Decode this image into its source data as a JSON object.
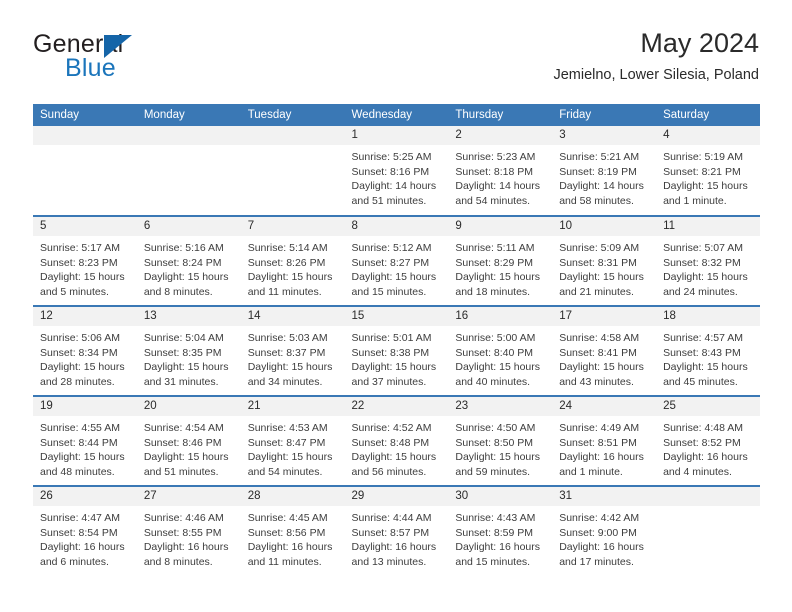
{
  "brand": {
    "name_part1": "General",
    "name_part2": "Blue",
    "triangle_color": "#1565a8",
    "blue_color": "#1b75bb"
  },
  "header": {
    "title": "May 2024",
    "subtitle": "Jemielno, Lower Silesia, Poland"
  },
  "theme": {
    "header_blue": "#3a78b5",
    "daynum_band": "#f2f2f2",
    "text": "#3d3d3d"
  },
  "labels": {
    "sunrise_prefix": "Sunrise:",
    "sunset_prefix": "Sunset:",
    "daylight_prefix": "Daylight:"
  },
  "weekdays": [
    "Sunday",
    "Monday",
    "Tuesday",
    "Wednesday",
    "Thursday",
    "Friday",
    "Saturday"
  ],
  "weeks": [
    [
      {
        "day": "",
        "sunrise": "",
        "sunset": "",
        "daylight": ""
      },
      {
        "day": "",
        "sunrise": "",
        "sunset": "",
        "daylight": ""
      },
      {
        "day": "",
        "sunrise": "",
        "sunset": "",
        "daylight": ""
      },
      {
        "day": "1",
        "sunrise": "Sunrise: 5:25 AM",
        "sunset": "Sunset: 8:16 PM",
        "daylight": "Daylight: 14 hours and 51 minutes."
      },
      {
        "day": "2",
        "sunrise": "Sunrise: 5:23 AM",
        "sunset": "Sunset: 8:18 PM",
        "daylight": "Daylight: 14 hours and 54 minutes."
      },
      {
        "day": "3",
        "sunrise": "Sunrise: 5:21 AM",
        "sunset": "Sunset: 8:19 PM",
        "daylight": "Daylight: 14 hours and 58 minutes."
      },
      {
        "day": "4",
        "sunrise": "Sunrise: 5:19 AM",
        "sunset": "Sunset: 8:21 PM",
        "daylight": "Daylight: 15 hours and 1 minute."
      }
    ],
    [
      {
        "day": "5",
        "sunrise": "Sunrise: 5:17 AM",
        "sunset": "Sunset: 8:23 PM",
        "daylight": "Daylight: 15 hours and 5 minutes."
      },
      {
        "day": "6",
        "sunrise": "Sunrise: 5:16 AM",
        "sunset": "Sunset: 8:24 PM",
        "daylight": "Daylight: 15 hours and 8 minutes."
      },
      {
        "day": "7",
        "sunrise": "Sunrise: 5:14 AM",
        "sunset": "Sunset: 8:26 PM",
        "daylight": "Daylight: 15 hours and 11 minutes."
      },
      {
        "day": "8",
        "sunrise": "Sunrise: 5:12 AM",
        "sunset": "Sunset: 8:27 PM",
        "daylight": "Daylight: 15 hours and 15 minutes."
      },
      {
        "day": "9",
        "sunrise": "Sunrise: 5:11 AM",
        "sunset": "Sunset: 8:29 PM",
        "daylight": "Daylight: 15 hours and 18 minutes."
      },
      {
        "day": "10",
        "sunrise": "Sunrise: 5:09 AM",
        "sunset": "Sunset: 8:31 PM",
        "daylight": "Daylight: 15 hours and 21 minutes."
      },
      {
        "day": "11",
        "sunrise": "Sunrise: 5:07 AM",
        "sunset": "Sunset: 8:32 PM",
        "daylight": "Daylight: 15 hours and 24 minutes."
      }
    ],
    [
      {
        "day": "12",
        "sunrise": "Sunrise: 5:06 AM",
        "sunset": "Sunset: 8:34 PM",
        "daylight": "Daylight: 15 hours and 28 minutes."
      },
      {
        "day": "13",
        "sunrise": "Sunrise: 5:04 AM",
        "sunset": "Sunset: 8:35 PM",
        "daylight": "Daylight: 15 hours and 31 minutes."
      },
      {
        "day": "14",
        "sunrise": "Sunrise: 5:03 AM",
        "sunset": "Sunset: 8:37 PM",
        "daylight": "Daylight: 15 hours and 34 minutes."
      },
      {
        "day": "15",
        "sunrise": "Sunrise: 5:01 AM",
        "sunset": "Sunset: 8:38 PM",
        "daylight": "Daylight: 15 hours and 37 minutes."
      },
      {
        "day": "16",
        "sunrise": "Sunrise: 5:00 AM",
        "sunset": "Sunset: 8:40 PM",
        "daylight": "Daylight: 15 hours and 40 minutes."
      },
      {
        "day": "17",
        "sunrise": "Sunrise: 4:58 AM",
        "sunset": "Sunset: 8:41 PM",
        "daylight": "Daylight: 15 hours and 43 minutes."
      },
      {
        "day": "18",
        "sunrise": "Sunrise: 4:57 AM",
        "sunset": "Sunset: 8:43 PM",
        "daylight": "Daylight: 15 hours and 45 minutes."
      }
    ],
    [
      {
        "day": "19",
        "sunrise": "Sunrise: 4:55 AM",
        "sunset": "Sunset: 8:44 PM",
        "daylight": "Daylight: 15 hours and 48 minutes."
      },
      {
        "day": "20",
        "sunrise": "Sunrise: 4:54 AM",
        "sunset": "Sunset: 8:46 PM",
        "daylight": "Daylight: 15 hours and 51 minutes."
      },
      {
        "day": "21",
        "sunrise": "Sunrise: 4:53 AM",
        "sunset": "Sunset: 8:47 PM",
        "daylight": "Daylight: 15 hours and 54 minutes."
      },
      {
        "day": "22",
        "sunrise": "Sunrise: 4:52 AM",
        "sunset": "Sunset: 8:48 PM",
        "daylight": "Daylight: 15 hours and 56 minutes."
      },
      {
        "day": "23",
        "sunrise": "Sunrise: 4:50 AM",
        "sunset": "Sunset: 8:50 PM",
        "daylight": "Daylight: 15 hours and 59 minutes."
      },
      {
        "day": "24",
        "sunrise": "Sunrise: 4:49 AM",
        "sunset": "Sunset: 8:51 PM",
        "daylight": "Daylight: 16 hours and 1 minute."
      },
      {
        "day": "25",
        "sunrise": "Sunrise: 4:48 AM",
        "sunset": "Sunset: 8:52 PM",
        "daylight": "Daylight: 16 hours and 4 minutes."
      }
    ],
    [
      {
        "day": "26",
        "sunrise": "Sunrise: 4:47 AM",
        "sunset": "Sunset: 8:54 PM",
        "daylight": "Daylight: 16 hours and 6 minutes."
      },
      {
        "day": "27",
        "sunrise": "Sunrise: 4:46 AM",
        "sunset": "Sunset: 8:55 PM",
        "daylight": "Daylight: 16 hours and 8 minutes."
      },
      {
        "day": "28",
        "sunrise": "Sunrise: 4:45 AM",
        "sunset": "Sunset: 8:56 PM",
        "daylight": "Daylight: 16 hours and 11 minutes."
      },
      {
        "day": "29",
        "sunrise": "Sunrise: 4:44 AM",
        "sunset": "Sunset: 8:57 PM",
        "daylight": "Daylight: 16 hours and 13 minutes."
      },
      {
        "day": "30",
        "sunrise": "Sunrise: 4:43 AM",
        "sunset": "Sunset: 8:59 PM",
        "daylight": "Daylight: 16 hours and 15 minutes."
      },
      {
        "day": "31",
        "sunrise": "Sunrise: 4:42 AM",
        "sunset": "Sunset: 9:00 PM",
        "daylight": "Daylight: 16 hours and 17 minutes."
      },
      {
        "day": "",
        "sunrise": "",
        "sunset": "",
        "daylight": ""
      }
    ]
  ]
}
